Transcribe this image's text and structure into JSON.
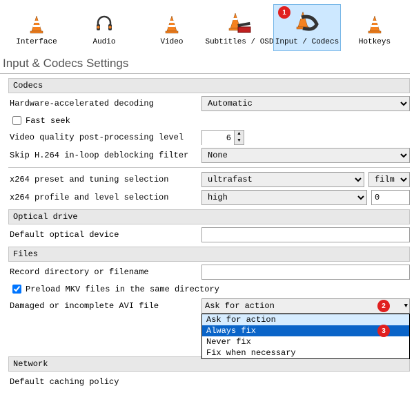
{
  "toolbar": {
    "items": [
      {
        "label": "Interface",
        "key": "interface"
      },
      {
        "label": "Audio",
        "key": "audio"
      },
      {
        "label": "Video",
        "key": "video"
      },
      {
        "label": "Subtitles / OSD",
        "key": "subtitles"
      },
      {
        "label": "Input / Codecs",
        "key": "input-codecs",
        "selected": true
      },
      {
        "label": "Hotkeys",
        "key": "hotkeys"
      }
    ]
  },
  "page_title": "Input & Codecs Settings",
  "groups": {
    "codecs": {
      "header": "Codecs",
      "hw_decoding_label": "Hardware-accelerated decoding",
      "hw_decoding_value": "Automatic",
      "fast_seek_label": "Fast seek",
      "fast_seek_checked": false,
      "post_processing_label": "Video quality post-processing level",
      "post_processing_value": "6",
      "skip_h264_label": "Skip H.264 in-loop deblocking filter",
      "skip_h264_value": "None",
      "x264_preset_label": "x264 preset and tuning selection",
      "x264_preset_value": "ultrafast",
      "x264_tuning_value": "film",
      "x264_profile_label": "x264 profile and level selection",
      "x264_profile_value": "high",
      "x264_level_value": "0"
    },
    "optical": {
      "header": "Optical drive",
      "default_device_label": "Default optical device",
      "default_device_value": ""
    },
    "files": {
      "header": "Files",
      "record_dir_label": "Record directory or filename",
      "record_dir_value": "",
      "preload_mkv_label": "Preload MKV files in the same directory",
      "preload_mkv_checked": true,
      "avi_label": "Damaged or incomplete AVI file",
      "avi_selected": "Ask for action",
      "avi_options": [
        "Ask for action",
        "Always fix",
        "Never fix",
        "Fix when necessary"
      ],
      "avi_highlight_index": 1
    },
    "network": {
      "header": "Network",
      "caching_label": "Default caching policy"
    }
  },
  "annotations": {
    "b1": "1",
    "b2": "2",
    "b3": "3"
  }
}
